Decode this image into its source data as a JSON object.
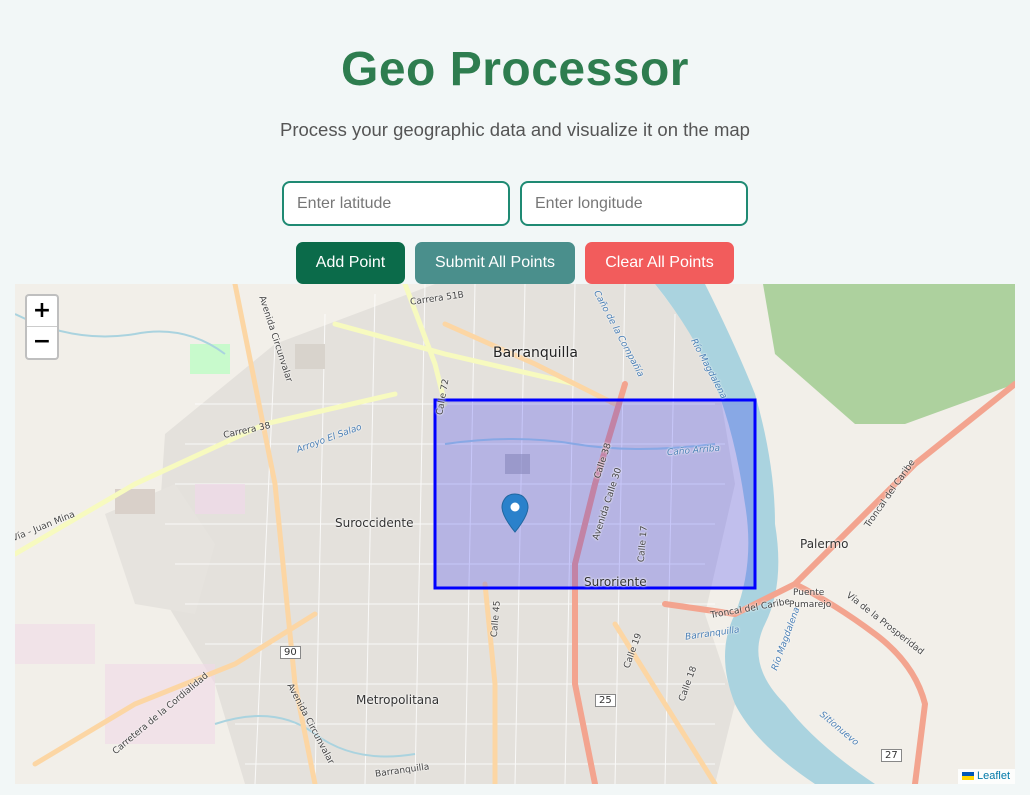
{
  "header": {
    "title": "Geo Processor",
    "subtitle": "Process your geographic data and visualize it on the map"
  },
  "form": {
    "latitude_placeholder": "Enter latitude",
    "longitude_placeholder": "Enter longitude",
    "latitude_value": "",
    "longitude_value": ""
  },
  "buttons": {
    "add": "Add Point",
    "submit": "Submit All Points",
    "clear": "Clear All Points"
  },
  "map": {
    "zoom_in": "+",
    "zoom_out": "−",
    "attribution": "Leaflet",
    "labels": {
      "barranquilla": "Barranquilla",
      "suroccidente": "Suroccidente",
      "suroriente": "Suroriente",
      "metropolitana": "Metropolitana",
      "palermo": "Palermo",
      "puente_pumarejo_1": "Puente",
      "puente_pumarejo_2": "Pumarejo",
      "carrera_38": "Carrera 38",
      "carrera_51b": "Carrera 51B",
      "calle_72": "Calle 72",
      "calle_30": "Avenida Calle 30",
      "calle_38": "Calle 38",
      "calle_17": "Calle 17",
      "calle_45": "Calle 45",
      "calle_19": "Calle 19",
      "calle_18": "Calle 18",
      "troncal": "Troncal del Caribe",
      "troncal_2": "Troncal del Caribe",
      "via_prosperidad": "Vía de la Prosperidad",
      "circunvalar": "Avenida Circunvalar",
      "circunvalar_2": "Avenida Circunvalar",
      "cordialidad": "Carretera de la Cordialidad",
      "juan_mina": "Vía - Juan Mina",
      "rio_magdalena": "Río Magdalena",
      "rio_magdalena_2": "Río Magdalena",
      "arroyo": "Arroyo El Salao",
      "cano_arriba": "Caño Arriba",
      "cano_compania": "Caño de la Compañía",
      "sitionuevo": "Sitionuevo",
      "barranquilla_bottom": "Barranquilla",
      "barranquilla_small": "Barranquilla",
      "shield_90": "90",
      "shield_25": "25",
      "shield_27": "27"
    },
    "selection_color": "#0000ff",
    "marker_color": "#2a81cb"
  }
}
